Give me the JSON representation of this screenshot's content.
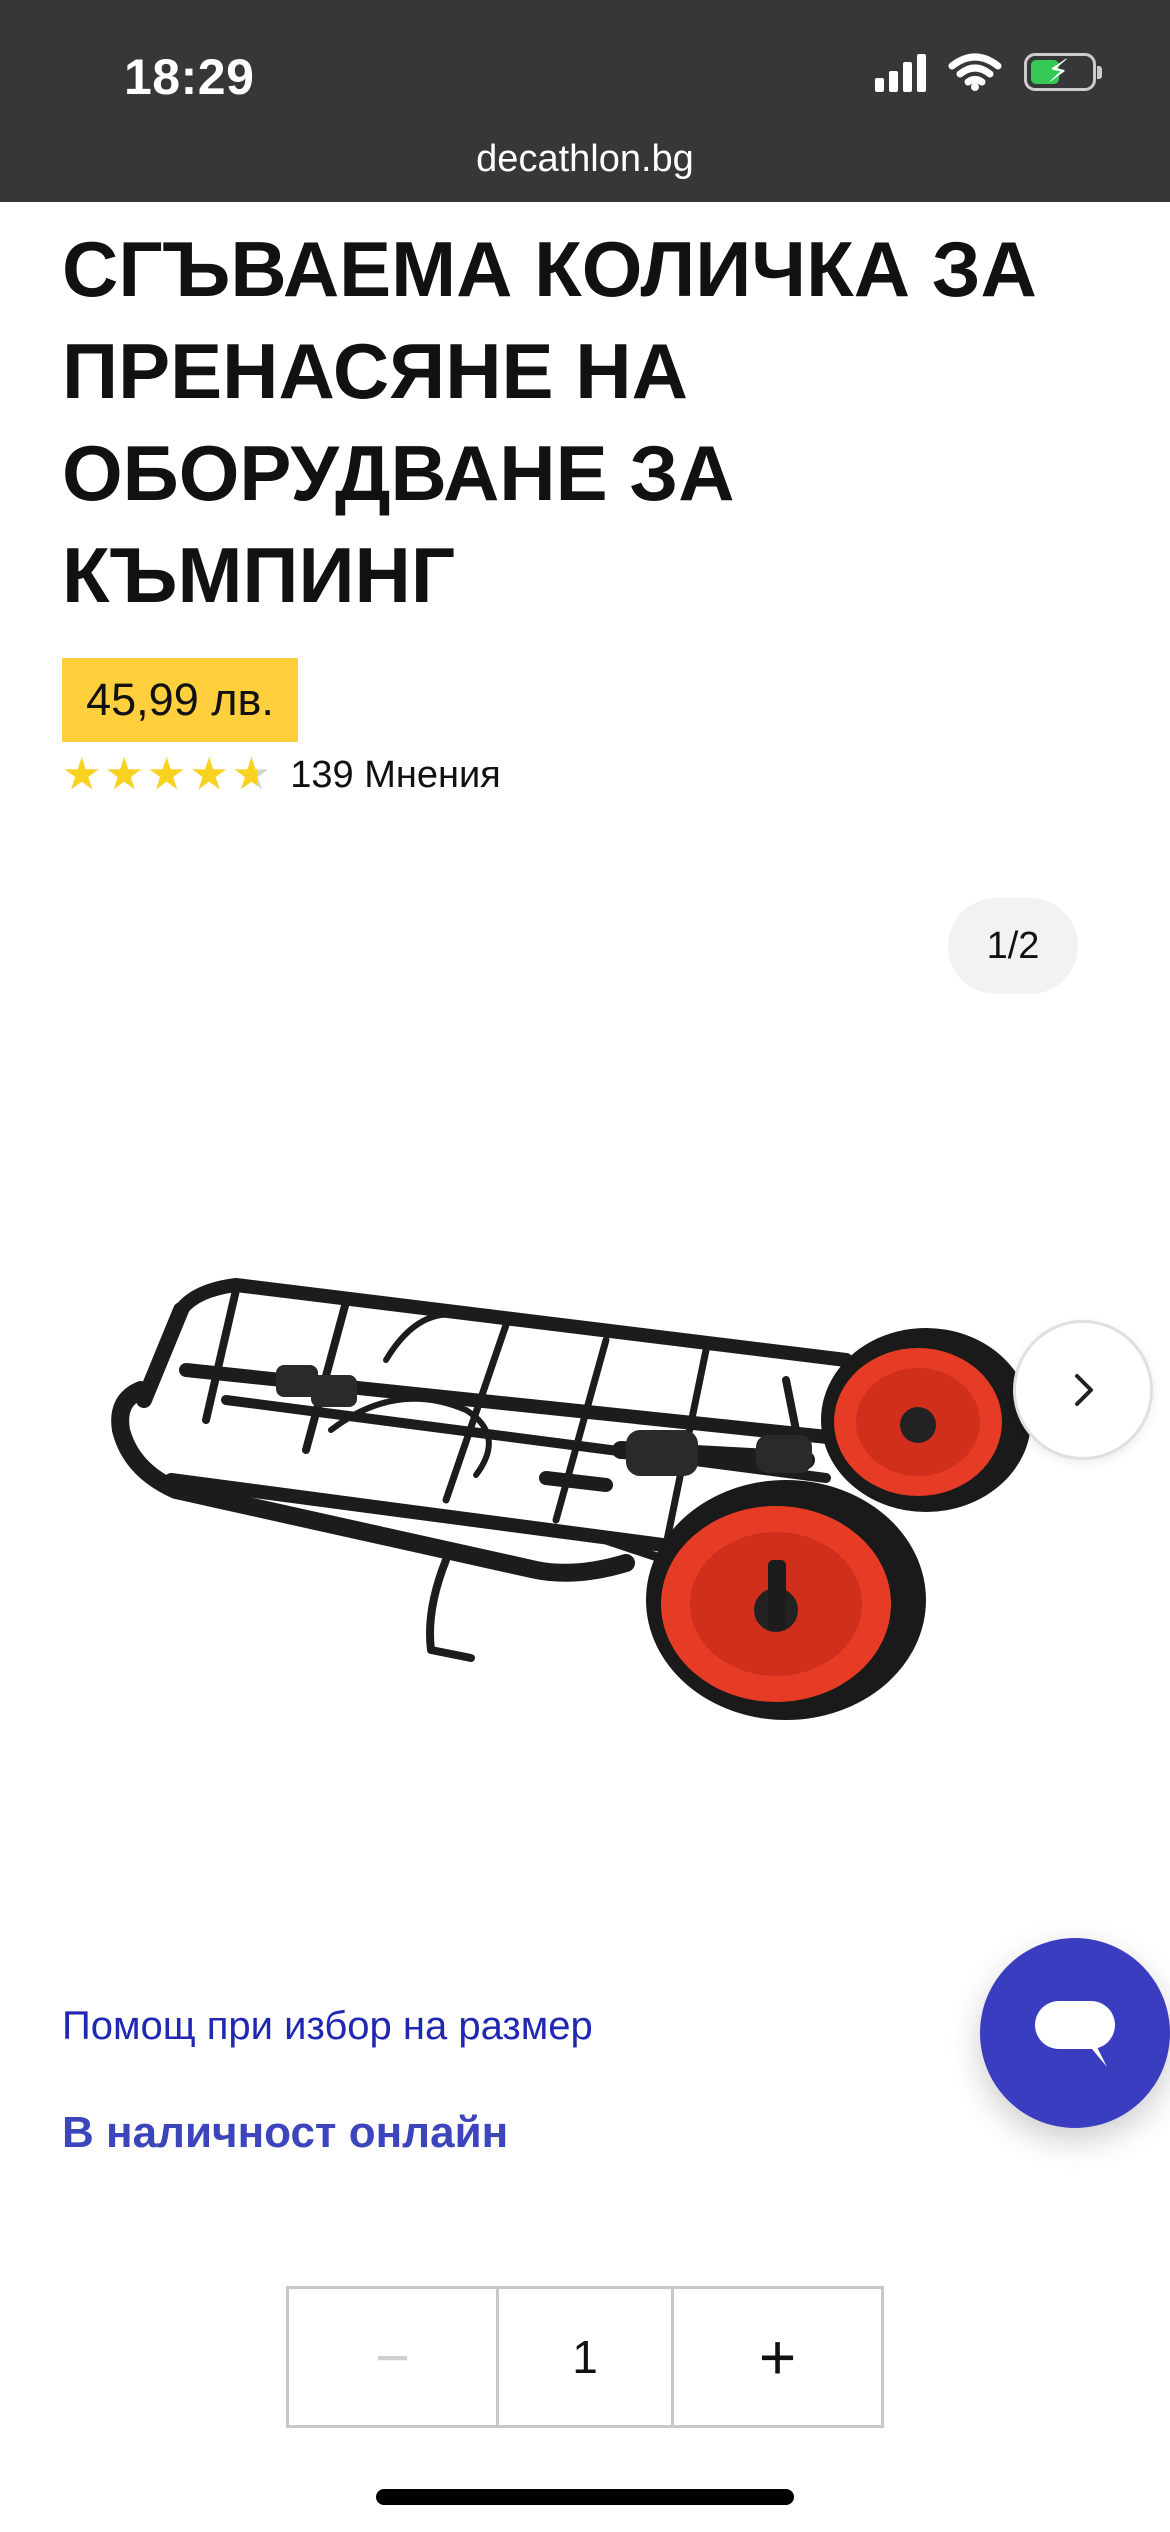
{
  "status_bar": {
    "time": "18:29",
    "icons": [
      "signal-icon",
      "wifi-icon",
      "battery-charging-icon"
    ],
    "battery_level": 0.48
  },
  "browser": {
    "url": "decathlon.bg"
  },
  "product": {
    "title": "СГЪВАЕМА КОЛИЧКА ЗА ПРЕНАСЯНЕ НА ОБОРУДВАНЕ ЗА КЪМПИНГ",
    "price": "45,99 лв.",
    "rating": {
      "value": 4.6,
      "max": 5,
      "stars": "★★★★★",
      "reviews": "139 Мнения"
    },
    "image_counter": "1/2",
    "next_icon": "chevron-right-icon",
    "image_name": "folding-camping-trolley"
  },
  "links": {
    "size_help": "Помощ при избор на размер"
  },
  "stock": {
    "availability": "В наличност онлайн"
  },
  "chat": {
    "icon": "chat-bubble-icon"
  },
  "quantity": {
    "minus": "−",
    "value": "1",
    "plus": "+"
  },
  "colors": {
    "topbar": "#353739",
    "price_highlight": "#ffcf3d",
    "link": "#1f27b3",
    "availability": "#3c45bc",
    "chat": "#3a3dbf",
    "wheel_red": "#e63b24",
    "star": "#f8d21e"
  }
}
